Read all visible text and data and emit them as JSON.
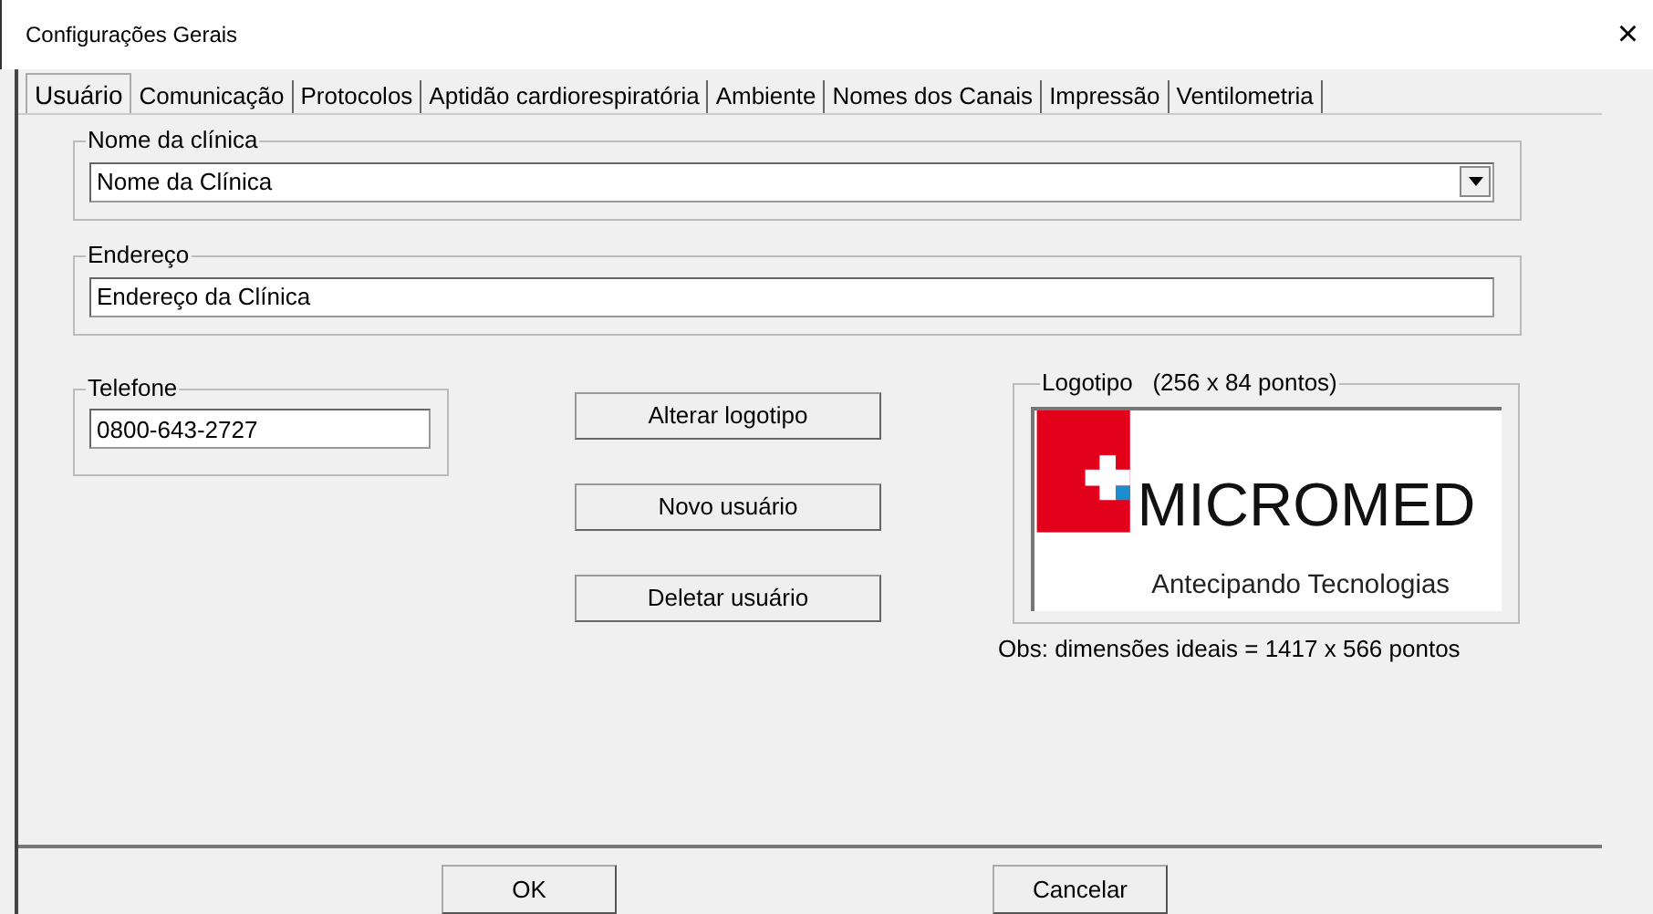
{
  "window": {
    "title": "Configurações Gerais",
    "close": "×"
  },
  "tabs": [
    {
      "label": "Usuário",
      "selected": true
    },
    {
      "label": "Comunicação",
      "selected": false
    },
    {
      "label": "Protocolos",
      "selected": false
    },
    {
      "label": "Aptidão cardiorespiratória",
      "selected": false
    },
    {
      "label": "Ambiente",
      "selected": false
    },
    {
      "label": "Nomes dos Canais",
      "selected": false
    },
    {
      "label": "Impressão",
      "selected": false
    },
    {
      "label": "Ventilometria",
      "selected": false
    }
  ],
  "clinic_name": {
    "label": "Nome da clínica",
    "value": "Nome da Clínica"
  },
  "address": {
    "label": "Endereço",
    "value": "Endereço da Clínica"
  },
  "phone": {
    "label": "Telefone",
    "value": "0800-643-2727"
  },
  "actions": [
    "Alterar logotipo",
    "Novo usuário",
    "Deletar usuário"
  ],
  "logo": {
    "label": "Logotipo   (256 x 84 pontos)",
    "brand": "MICROMED",
    "tagline": "Antecipando Tecnologias",
    "note": "Obs: dimensões ideais = 1417 x 566  pontos"
  },
  "buttons": [
    "OK",
    "Cancelar"
  ]
}
